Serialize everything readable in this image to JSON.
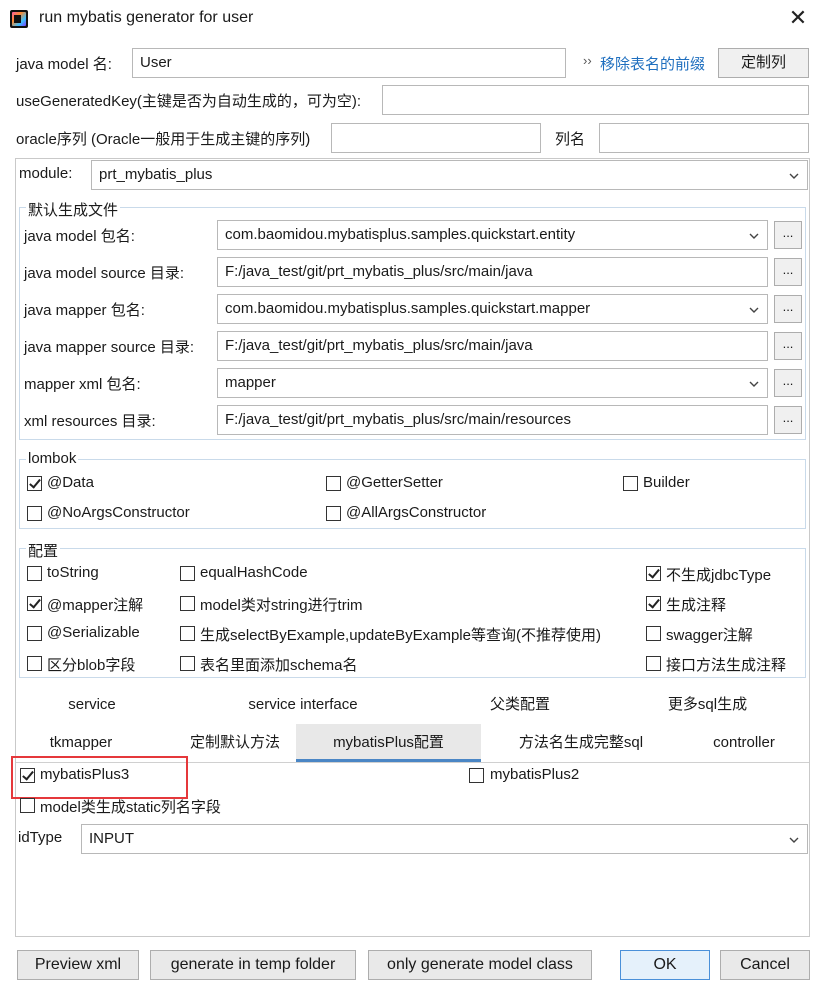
{
  "window": {
    "title": "run mybatis generator for user",
    "close_icon": "close-icon"
  },
  "top": {
    "model_name_label": "java model 名:",
    "model_name_value": "User",
    "remove_prefix_link": "移除表名的前缀",
    "custom_columns_button": "定制列",
    "generated_key_label": "useGeneratedKey(主键是否为自动生成的，可为空):",
    "generated_key_value": "",
    "oracle_seq_label": "oracle序列 (Oracle一般用于生成主键的序列)",
    "oracle_seq_value": "",
    "column_name_label": "列名",
    "column_name_value": ""
  },
  "module": {
    "label": "module:",
    "value": "prt_mybatis_plus"
  },
  "default_files": {
    "title": "默认生成文件",
    "rows": [
      {
        "label": "java model 包名:",
        "value": "com.baomidou.mybatisplus.samples.quickstart.entity",
        "dropdown": true
      },
      {
        "label": "java model source 目录:",
        "value": "F:/java_test/git/prt_mybatis_plus/src/main/java",
        "dropdown": false
      },
      {
        "label": "java mapper 包名:",
        "value": "com.baomidou.mybatisplus.samples.quickstart.mapper",
        "dropdown": true
      },
      {
        "label": "java mapper source 目录:",
        "value": "F:/java_test/git/prt_mybatis_plus/src/main/java",
        "dropdown": false
      },
      {
        "label": "mapper xml 包名:",
        "value": "mapper",
        "dropdown": true
      },
      {
        "label": "xml resources 目录:",
        "value": "F:/java_test/git/prt_mybatis_plus/src/main/resources",
        "dropdown": false
      }
    ],
    "browse_label": "..."
  },
  "lombok": {
    "title": "lombok",
    "items": [
      {
        "label": "@Data",
        "checked": true
      },
      {
        "label": "@GetterSetter",
        "checked": false
      },
      {
        "label": "Builder",
        "checked": false
      },
      {
        "label": "@NoArgsConstructor",
        "checked": false
      },
      {
        "label": "@AllArgsConstructor",
        "checked": false
      }
    ]
  },
  "config": {
    "title": "配置",
    "items": [
      {
        "label": "toString",
        "checked": false
      },
      {
        "label": "equalHashCode",
        "checked": false
      },
      {
        "label": "不生成jdbcType",
        "checked": true
      },
      {
        "label": "@mapper注解",
        "checked": true
      },
      {
        "label": "model类对string进行trim",
        "checked": false
      },
      {
        "label": "生成注释",
        "checked": true
      },
      {
        "label": "@Serializable",
        "checked": false
      },
      {
        "label": "生成selectByExample,updateByExample等查询(不推荐使用)",
        "checked": false
      },
      {
        "label": "swagger注解",
        "checked": false
      },
      {
        "label": "区分blob字段",
        "checked": false
      },
      {
        "label": "表名里面添加schema名",
        "checked": false
      },
      {
        "label": "接口方法生成注释",
        "checked": false
      }
    ]
  },
  "tabs": {
    "row1": [
      "service",
      "service interface",
      "父类配置",
      "更多sql生成"
    ],
    "row2": [
      "tkmapper",
      "定制默认方法",
      "mybatisPlus配置",
      "方法名生成完整sql",
      "controller"
    ],
    "active": "mybatisPlus配置"
  },
  "mybatis_plus": {
    "plus3": {
      "label": "mybatisPlus3",
      "checked": true
    },
    "plus2": {
      "label": "mybatisPlus2",
      "checked": false
    },
    "static_fields": {
      "label": "model类生成static列名字段",
      "checked": false
    },
    "id_type_label": "idType",
    "id_type_value": "INPUT"
  },
  "buttons": {
    "preview": "Preview xml",
    "temp": "generate in temp folder",
    "model_only": "only generate model class",
    "ok": "OK",
    "cancel": "Cancel"
  }
}
